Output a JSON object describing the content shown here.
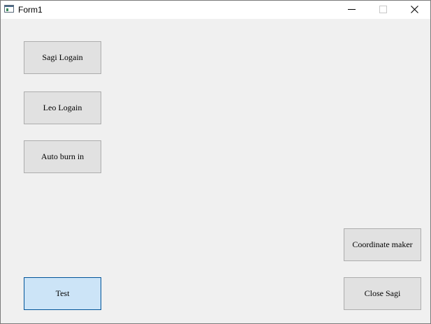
{
  "window": {
    "title": "Form1",
    "icon": "form-window-icon",
    "controls": {
      "minimize_icon": "minimize-icon",
      "maximize_icon": "maximize-icon",
      "close_icon": "close-icon"
    }
  },
  "buttons": {
    "sagi_login": "Sagi Logain",
    "leo_login": "Leo Logain",
    "auto_burn_in": "Auto burn in",
    "test": "Test",
    "coordinate_maker": "Coordinate maker",
    "close_sagi": "Close Sagi"
  },
  "colors": {
    "form_background": "#f0f0f0",
    "button_face": "#e1e1e1",
    "button_border": "#adadad",
    "focused_button_face": "#cce4f7",
    "focused_button_border": "#005499"
  }
}
